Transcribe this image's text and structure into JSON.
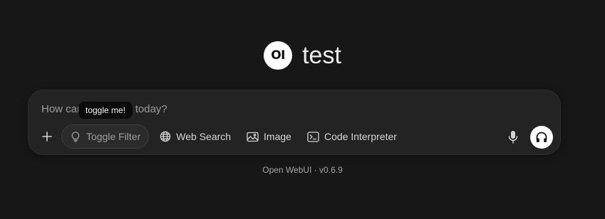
{
  "brand": {
    "logo_text": "OI",
    "title": "test"
  },
  "composer": {
    "placeholder": "How can I help you today?",
    "tooltip": "toggle me!",
    "toolbar": {
      "add_icon": "plus-icon",
      "filter": {
        "icon": "lightbulb-icon",
        "label": "Toggle Filter"
      },
      "web_search": {
        "icon": "globe-icon",
        "label": "Web Search"
      },
      "image": {
        "icon": "image-icon",
        "label": "Image"
      },
      "code_interpreter": {
        "icon": "terminal-icon",
        "label": "Code Interpreter"
      }
    },
    "mic_icon": "microphone-icon",
    "voice_icon": "headphones-icon"
  },
  "footer": {
    "text": "Open WebUI · v0.6.9"
  },
  "colors": {
    "background": "#171717",
    "composer": "#232323",
    "text": "#e5e5e5"
  }
}
